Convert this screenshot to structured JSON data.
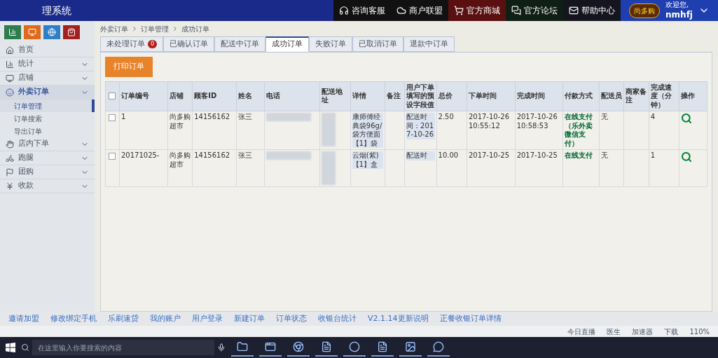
{
  "header": {
    "title": "理系统",
    "nav": [
      {
        "label": "咨询客服",
        "color": "#111111"
      },
      {
        "label": "商户联盟",
        "color": "#111111"
      },
      {
        "label": "官方商城",
        "color": "#5a1010"
      },
      {
        "label": "官方论坛",
        "color": "#0f1f16"
      },
      {
        "label": "帮助中心",
        "color": "#15151f"
      }
    ],
    "user": {
      "logo": "尚多购",
      "greeting": "欢迎您,",
      "name": "nmhfj"
    }
  },
  "quick_buttons": [
    {
      "color": "#2e7d4f"
    },
    {
      "color": "#e06a1b"
    },
    {
      "color": "#2f7fc8"
    },
    {
      "color": "#a32020"
    }
  ],
  "breadcrumb": [
    "外卖订单",
    "订单管理",
    "成功订单"
  ],
  "sidebar": {
    "items": [
      {
        "label": "首页",
        "expanded": false
      },
      {
        "label": "统计",
        "expanded": false
      },
      {
        "label": "店铺",
        "expanded": false
      },
      {
        "label": "外卖订单",
        "expanded": true,
        "children": [
          {
            "label": "订单管理",
            "selected": true
          },
          {
            "label": "订单搜索",
            "selected": false
          },
          {
            "label": "导出订单",
            "selected": false
          }
        ]
      },
      {
        "label": "店内下单",
        "expanded": false
      },
      {
        "label": "跑腿",
        "expanded": false
      },
      {
        "label": "团购",
        "expanded": false
      },
      {
        "label": "收款",
        "expanded": false
      }
    ]
  },
  "tabs": [
    {
      "label": "未处理订单",
      "badge": "0",
      "selected": false
    },
    {
      "label": "已确认订单",
      "selected": false
    },
    {
      "label": "配送中订单",
      "selected": false
    },
    {
      "label": "成功订单",
      "selected": true
    },
    {
      "label": "失败订单",
      "selected": false
    },
    {
      "label": "已取消订单",
      "selected": false
    },
    {
      "label": "退款中订单",
      "selected": false
    }
  ],
  "print_button": "打印订单",
  "table": {
    "select_all": false,
    "columns": [
      "订单编号",
      "店铺",
      "顾客ID",
      "姓名",
      "电话",
      "配送地址",
      "详情",
      "备注",
      "用户下单填写的预设字段值",
      "总价",
      "下单时间",
      "完成时间",
      "付款方式",
      "配送员",
      "商家备注",
      "完成速度（分钟）",
      "操作"
    ],
    "rows": [
      {
        "checked": false,
        "order_no": "1",
        "store": "尚多购超市",
        "customer_id": "14156162",
        "name": "张三",
        "detail": "康师傅经典袋96g/袋方便面【1】袋",
        "preset": "配送时间：2017-10-26",
        "total": "2.50",
        "order_time": "2017-10-26 10:55:12",
        "finish_time": "2017-10-26 10:58:53",
        "payment": "在线支付（乐外卖微信支付）",
        "courier": "无",
        "speed": "4"
      },
      {
        "checked": false,
        "order_no": "20171025-",
        "store": "尚多购超市",
        "customer_id": "14156162",
        "name": "张三",
        "detail": "云烟(紫)【1】盒",
        "preset": "配送时",
        "total": "10.00",
        "order_time": "2017-10-25",
        "finish_time": "2017-10-25",
        "payment": "在线支付",
        "courier": "无",
        "speed": "1"
      }
    ]
  },
  "footer_links": [
    "邀请加盟",
    "修改绑定手机",
    "乐刷速贷",
    "我的账户",
    "用户登录",
    "新建订单",
    "订单状态",
    "收银台统计",
    "V2.1.14更新说明",
    "正餐收银订单详情"
  ],
  "browser_status": [
    "今日直播",
    "医生",
    "加速器",
    "下载",
    "110%"
  ],
  "taskbar": {
    "search": {
      "placeholder": "在这里输入你要搜索的内容"
    }
  }
}
